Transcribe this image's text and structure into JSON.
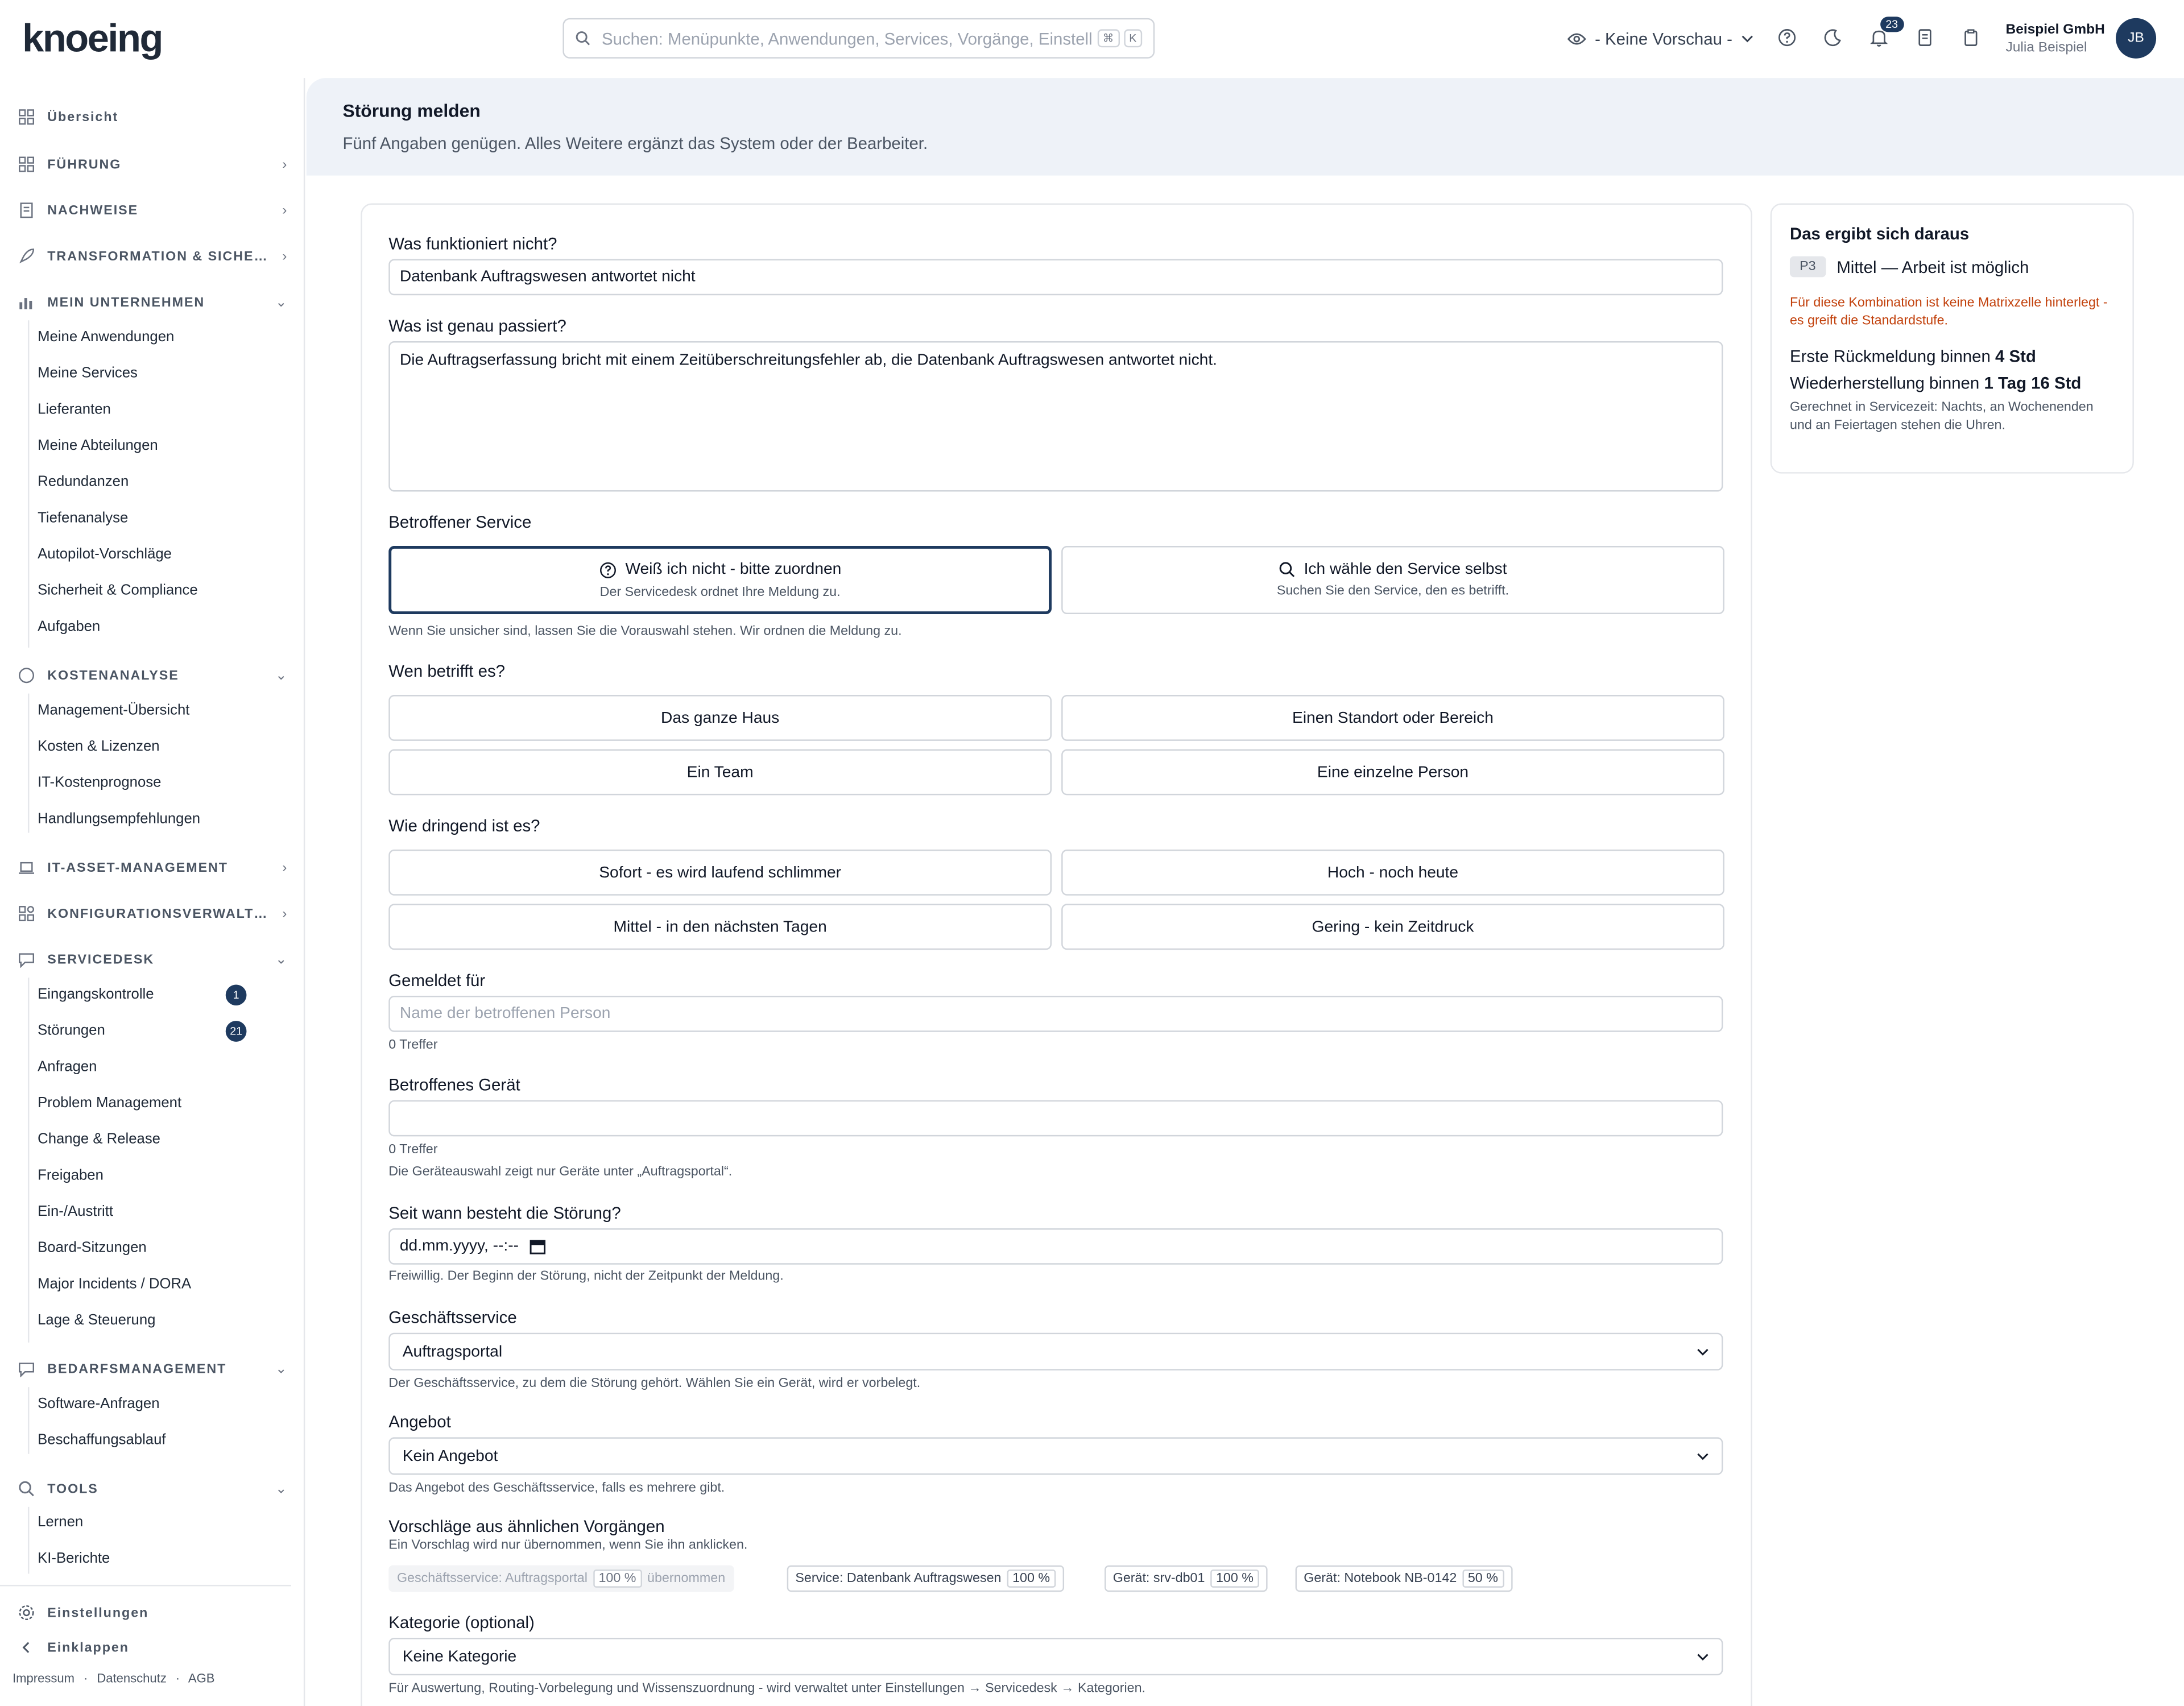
{
  "app": {
    "logo": "knoeing"
  },
  "search": {
    "placeholder": "Suchen: Menüpunkte, Anwendungen, Services, Vorgänge, Einstellungen",
    "kbd1": "⌘",
    "kbd2": "K"
  },
  "header": {
    "preview_label": "- Keine Vorschau -",
    "notifications": "23",
    "org": "Beispiel GmbH",
    "user": "Julia Beispiel",
    "initials": "JB"
  },
  "sidebar": {
    "overview": "Übersicht",
    "sections": {
      "fuehrung": "FÜHRUNG",
      "nachweise": "NACHWEISE",
      "transformation": "TRANSFORMATION & SICHERHEIT",
      "unternehmen": "MEIN UNTERNEHMEN",
      "kosten": "KOSTENANALYSE",
      "itam": "IT-ASSET-MANAGEMENT",
      "konfig": "KONFIGURATIONSVERWALTUNG",
      "servicedesk": "SERVICEDESK",
      "bedarf": "BEDARFSMANAGEMENT",
      "tools": "TOOLS"
    },
    "unternehmen_items": [
      "Meine Anwendungen",
      "Meine Services",
      "Lieferanten",
      "Meine Abteilungen",
      "Redundanzen",
      "Tiefenanalyse",
      "Autopilot-Vorschläge",
      "Sicherheit & Compliance",
      "Aufgaben"
    ],
    "kosten_items": [
      "Management-Übersicht",
      "Kosten & Lizenzen",
      "IT-Kostenprognose",
      "Handlungsempfehlungen"
    ],
    "servicedesk_items": [
      "Eingangskontrolle",
      "Störungen",
      "Anfragen",
      "Problem Management",
      "Change & Release",
      "Freigaben",
      "Ein-/Austritt",
      "Board-Sitzungen",
      "Major Incidents / DORA",
      "Lage & Steuerung"
    ],
    "servicedesk_counts": {
      "eingang": "1",
      "stoerungen": "21"
    },
    "bedarf_items": [
      "Software-Anfragen",
      "Beschaffungsablauf"
    ],
    "tools_items": [
      "Lernen",
      "KI-Berichte"
    ],
    "settings": "Einstellungen",
    "collapse": "Einklappen",
    "footer": {
      "impressum": "Impressum",
      "dot": "·",
      "datenschutz": "Datenschutz",
      "agb": "AGB"
    }
  },
  "page": {
    "title": "Störung melden",
    "subtitle": "Fünf Angaben genügen. Alles Weitere ergänzt das System oder der Bearbeiter."
  },
  "form": {
    "q1": "Was funktioniert nicht?",
    "q1_value": "Datenbank Auftragswesen antwortet nicht",
    "q2": "Was ist genau passiert?",
    "q2_value": "Die Auftragserfassung bricht mit einem Zeitüberschreitungsfehler ab, die Datenbank Auftragswesen antwortet nicht.",
    "service_label": "Betroffener Service",
    "service_opt1_title": "Weiß ich nicht - bitte zuordnen",
    "service_opt1_sub": "Der Servicedesk ordnet Ihre Meldung zu.",
    "service_opt2_title": "Ich wähle den Service selbst",
    "service_opt2_sub": "Suchen Sie den Service, den es betrifft.",
    "service_hint": "Wenn Sie unsicher sind, lassen Sie die Vorauswahl stehen. Wir ordnen die Meldung zu.",
    "who_label": "Wen betrifft es?",
    "who_opts": [
      "Das ganze Haus",
      "Einen Standort oder Bereich",
      "Ein Team",
      "Eine einzelne Person"
    ],
    "urg_label": "Wie dringend ist es?",
    "urg_opts": [
      "Sofort - es wird laufend schlimmer",
      "Hoch - noch heute",
      "Mittel - in den nächsten Tagen",
      "Gering - kein Zeitdruck"
    ],
    "reported_for": "Gemeldet für",
    "reported_ph": "Name der betroffenen Person",
    "hits1": "0 Treffer",
    "device_label": "Betroffenes Gerät",
    "hits2": "0 Treffer",
    "device_hint": "Die Geräteauswahl zeigt nur Geräte unter „Auftragsportal“.",
    "since_label": "Seit wann besteht die Störung?",
    "since_ph": "dd.mm.yyyy, --:--",
    "since_hint": "Freiwillig. Der Beginn der Störung, nicht der Zeitpunkt der Meldung.",
    "bs_label": "Geschäftsservice",
    "bs_value": "Auftragsportal",
    "bs_hint": "Der Geschäftsservice, zu dem die Störung gehört. Wählen Sie ein Gerät, wird er vorbelegt.",
    "offer_label": "Angebot",
    "offer_value": "Kein Angebot",
    "offer_hint": "Das Angebot des Geschäftsservice, falls es mehrere gibt.",
    "sugg_label": "Vorschläge aus ähnlichen Vorgängen",
    "sugg_hint": "Ein Vorschlag wird nur übernommen, wenn Sie ihn anklicken.",
    "chips": [
      {
        "text": "Geschäftsservice: Auftragsportal",
        "pct": "100 %",
        "extra": "übernommen"
      },
      {
        "text": "Service: Datenbank Auftragswesen",
        "pct": "100 %"
      },
      {
        "text": "Gerät: srv-db01",
        "pct": "100 %"
      },
      {
        "text": "Gerät: Notebook NB-0142",
        "pct": "50 %"
      }
    ],
    "cat_label": "Kategorie (optional)",
    "cat_value": "Keine Kategorie",
    "cat_hint": "Für Auswertung, Routing-Vorbelegung und Wissenszuordnung - wird verwaltet unter Einstellungen → Servicedesk → Kategorien."
  },
  "result": {
    "title": "Das ergibt sich daraus",
    "prio_badge": "P3",
    "prio_text": "Mittel — Arbeit ist möglich",
    "warn": "Für diese Kombination ist keine Matrixzelle hinterlegt - es greift die Standardstufe.",
    "first_label": "Erste Rückmeldung binnen",
    "first_value": "4 Std",
    "restore_label": "Wiederherstellung binnen",
    "restore_value": "1 Tag 16 Std",
    "note": "Gerechnet in Servicezeit: Nachts, an Wochenenden und an Feiertagen stehen die Uhren."
  }
}
